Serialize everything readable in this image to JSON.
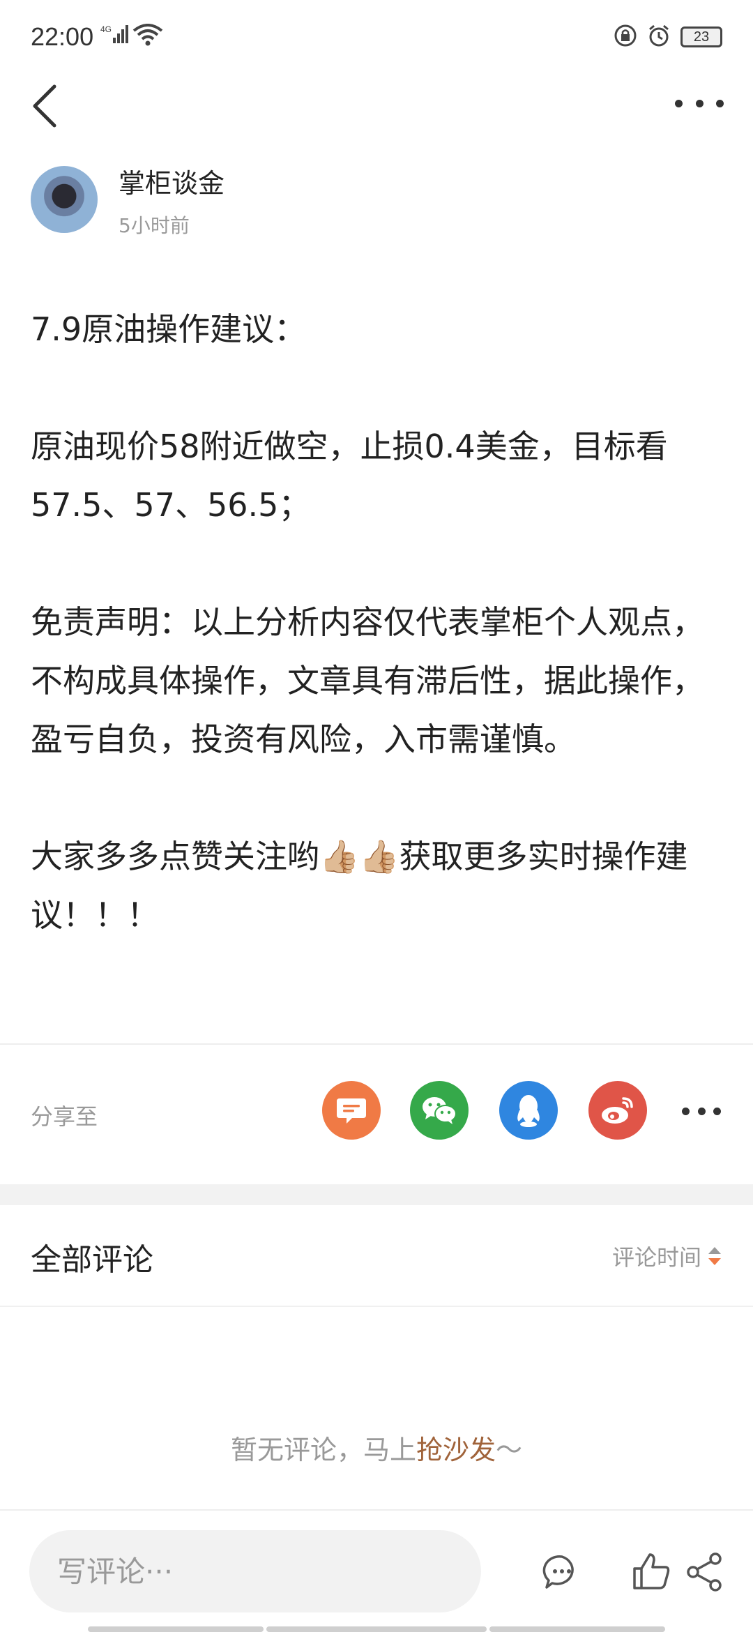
{
  "status_bar": {
    "time": "22:00",
    "network": "4G",
    "battery": "23"
  },
  "author": {
    "name": "掌柜谈金",
    "time": "5小时前"
  },
  "article": {
    "paragraphs": [
      "7.9原油操作建议：",
      "原油现价58附近做空，止损0.4美金，目标看57.5、57、56.5；",
      "免责声明：以上分析内容仅代表掌柜个人观点，不构成具体操作，文章具有滞后性，据此操作，盈亏自负，投资有风险，入市需谨慎。",
      "大家多多点赞关注哟👍🏼👍🏼获取更多实时操作建议！！！"
    ]
  },
  "share": {
    "label": "分享至",
    "targets": [
      "chat-icon",
      "wechat-icon",
      "qq-icon",
      "weibo-icon",
      "more-icon"
    ],
    "colors": {
      "chat": "#f07a45",
      "wechat": "#35a94a",
      "qq": "#2f86e0",
      "weibo": "#e05548"
    }
  },
  "comments": {
    "title": "全部评论",
    "sort_label": "评论时间",
    "empty_text": "暂无评论，马上",
    "empty_link": "抢沙发",
    "empty_suffix": "～"
  },
  "bottom_bar": {
    "placeholder": "写评论···"
  },
  "colors": {
    "accent": "#f07a45",
    "link": "#a0633a"
  }
}
